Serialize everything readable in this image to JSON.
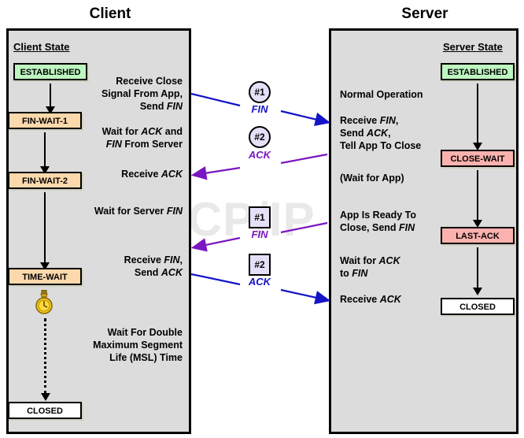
{
  "watermark": "The TCP/IP Guide",
  "columns": {
    "client_title": "Client",
    "server_title": "Server"
  },
  "client": {
    "state_heading": "Client State",
    "states": [
      {
        "label": "ESTABLISHED",
        "color": "#bff5c0"
      },
      {
        "label": "FIN-WAIT-1",
        "color": "#fbd9ad"
      },
      {
        "label": "FIN-WAIT-2",
        "color": "#fbd9ad"
      },
      {
        "label": "TIME-WAIT",
        "color": "#fbd9ad"
      },
      {
        "label": "CLOSED",
        "color": "#ffffff"
      }
    ],
    "annotations": [
      "Receive Close\nSignal From App,\nSend FIN",
      "Wait for ACK and\nFIN From Server",
      "Receive ACK",
      "Wait for Server FIN",
      "Receive FIN,\nSend ACK",
      "Wait For Double\nMaximum Segment\nLife (MSL) Time"
    ]
  },
  "server": {
    "state_heading": "Server State",
    "states": [
      {
        "label": "ESTABLISHED",
        "color": "#bff5c0"
      },
      {
        "label": "CLOSE-WAIT",
        "color": "#fbb2ae"
      },
      {
        "label": "LAST-ACK",
        "color": "#fbb2ae"
      },
      {
        "label": "CLOSED",
        "color": "#ffffff"
      }
    ],
    "annotations": [
      "Normal Operation",
      "Receive FIN,\nSend ACK,\nTell App To Close",
      "(Wait for App)",
      "App Is Ready To\nClose, Send FIN",
      "Wait for ACK\nto FIN",
      "Receive ACK"
    ]
  },
  "messages": [
    {
      "num": "#1",
      "label": "FIN",
      "shape": "circle",
      "direction": "client-to-server",
      "color": "#1414c8"
    },
    {
      "num": "#2",
      "label": "ACK",
      "shape": "circle",
      "direction": "server-to-client",
      "color": "#7a17c0"
    },
    {
      "num": "#1",
      "label": "FIN",
      "shape": "square",
      "direction": "server-to-client",
      "color": "#7a17c0"
    },
    {
      "num": "#2",
      "label": "ACK",
      "shape": "square",
      "direction": "client-to-server",
      "color": "#1414c8"
    }
  ],
  "icons": {
    "timer": "stopwatch-icon"
  },
  "colors": {
    "panel_bg": "#dcdcdc",
    "established": "#bff5c0",
    "fin_wait": "#fbd9ad",
    "close_wait": "#fbb2ae",
    "closed": "#ffffff",
    "blue_arrow": "#1414c8",
    "purple_arrow": "#7a17c0"
  }
}
